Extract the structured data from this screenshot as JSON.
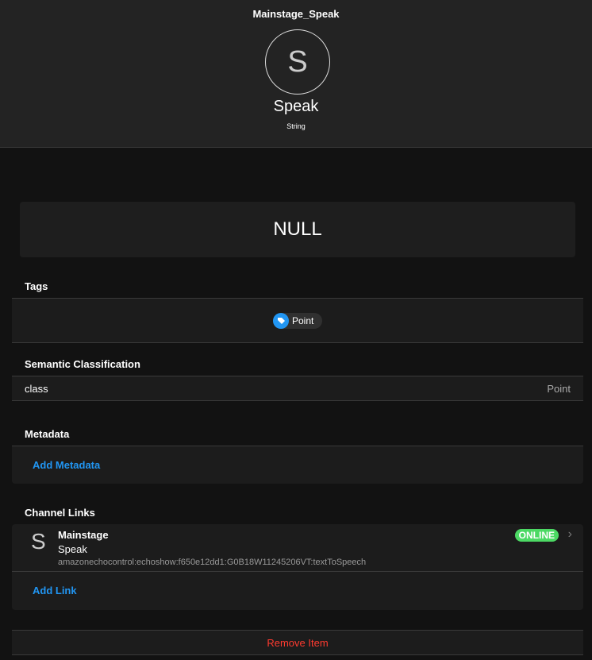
{
  "header": {
    "title": "Mainstage_Speak",
    "avatar_letter": "S",
    "label": "Speak",
    "type": "String"
  },
  "state": "NULL",
  "tags": {
    "heading": "Tags",
    "items": [
      "Point"
    ]
  },
  "semantic": {
    "heading": "Semantic Classification",
    "key": "class",
    "value": "Point"
  },
  "metadata": {
    "heading": "Metadata",
    "add_label": "Add Metadata"
  },
  "channel_links": {
    "heading": "Channel Links",
    "items": [
      {
        "icon_letter": "S",
        "thing": "Mainstage",
        "channel": "Speak",
        "uid": "amazonechocontrol:echoshow:f650e12dd1:G0B18W11245206VT:textToSpeech",
        "status": "ONLINE"
      }
    ],
    "add_label": "Add Link"
  },
  "remove_label": "Remove Item",
  "colors": {
    "accent": "#2196f3",
    "online": "#4cd964",
    "danger": "#ff3b30"
  }
}
